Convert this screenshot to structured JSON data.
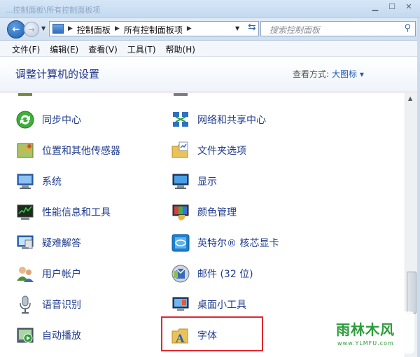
{
  "titlebar": {
    "title": "...控制面板\\所有控制面板项"
  },
  "address": {
    "crumbs": [
      "控制面板",
      "所有控制面板项"
    ],
    "search_placeholder": "搜索控制面板"
  },
  "menu": [
    "文件(F)",
    "编辑(E)",
    "查看(V)",
    "工具(T)",
    "帮助(H)"
  ],
  "header": {
    "title": "调整计算机的设置",
    "viewby_label": "查看方式:",
    "viewby_value": "大图标 ▾"
  },
  "items_left": [
    {
      "label": "同步中心",
      "icon": "sync-center-icon"
    },
    {
      "label": "位置和其他传感器",
      "icon": "location-sensors-icon"
    },
    {
      "label": "系统",
      "icon": "system-icon"
    },
    {
      "label": "性能信息和工具",
      "icon": "performance-icon"
    },
    {
      "label": "疑难解答",
      "icon": "troubleshooting-icon"
    },
    {
      "label": "用户帐户",
      "icon": "user-accounts-icon"
    },
    {
      "label": "语音识别",
      "icon": "speech-recognition-icon"
    },
    {
      "label": "自动播放",
      "icon": "autoplay-icon"
    }
  ],
  "items_right": [
    {
      "label": "网络和共享中心",
      "icon": "network-sharing-icon"
    },
    {
      "label": "文件夹选项",
      "icon": "folder-options-icon"
    },
    {
      "label": "显示",
      "icon": "display-icon"
    },
    {
      "label": "颜色管理",
      "icon": "color-management-icon"
    },
    {
      "label": "英特尔® 核芯显卡",
      "icon": "intel-graphics-icon"
    },
    {
      "label": "邮件 (32 位)",
      "icon": "mail-icon"
    },
    {
      "label": "桌面小工具",
      "icon": "desktop-gadgets-icon"
    },
    {
      "label": "字体",
      "icon": "fonts-icon"
    }
  ],
  "watermark": {
    "main": "雨林木风",
    "sub": "www.YLMFU.com"
  },
  "colors": {
    "link": "#1f3b8c",
    "highlight": "#e0292d",
    "title": "#1e3287"
  }
}
